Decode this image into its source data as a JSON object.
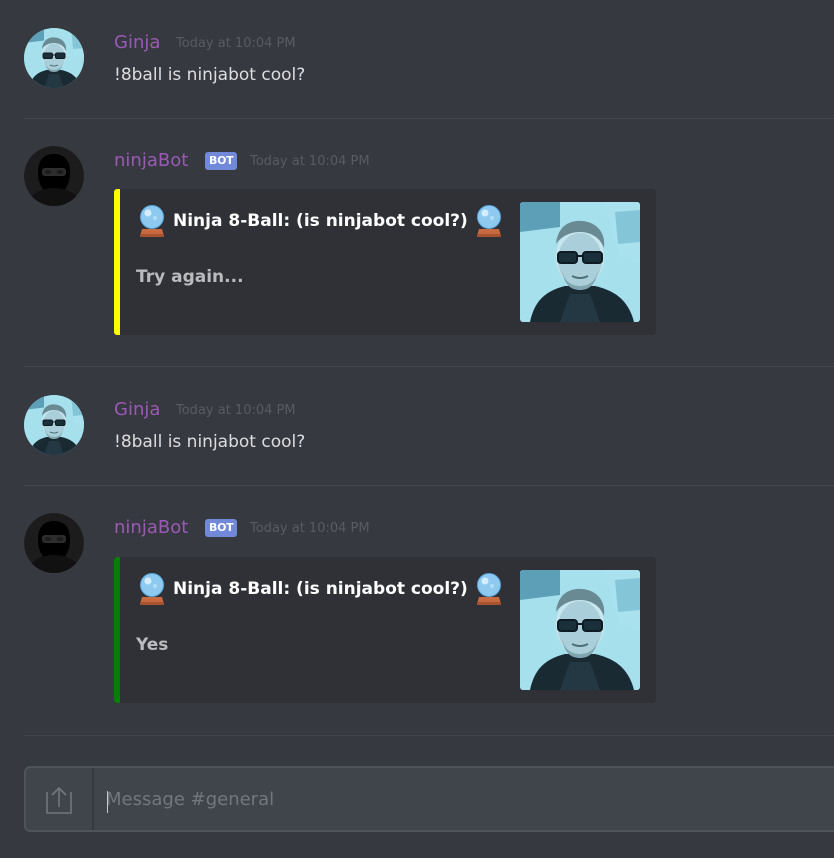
{
  "colors": {
    "background": "#36393f",
    "user_name": "#9b59b6",
    "bot_name": "#9b59b6",
    "bot_badge": "#7289da",
    "embed_bg": "#2f3136",
    "embed_bar_1": "#ffff00",
    "embed_bar_2": "#008000"
  },
  "messages": [
    {
      "author": "Ginja",
      "avatar_icon": "user-avatar-photo",
      "timestamp": "Today at 10:04 PM",
      "content": "!8ball is ninjabot cool?"
    },
    {
      "author": "ninjaBot",
      "badge": "BOT",
      "avatar_icon": "ninja-bot-avatar",
      "timestamp": "Today at 10:04 PM",
      "embed": {
        "title": "Ninja 8-Ball: (is ninjabot cool?)",
        "title_icon": "crystal-ball-icon",
        "description": "Try again...",
        "bar_color": "yellow",
        "thumbnail_icon": "user-photo-thumbnail"
      }
    },
    {
      "author": "Ginja",
      "avatar_icon": "user-avatar-photo",
      "timestamp": "Today at 10:04 PM",
      "content": "!8ball is ninjabot cool?"
    },
    {
      "author": "ninjaBot",
      "badge": "BOT",
      "avatar_icon": "ninja-bot-avatar",
      "timestamp": "Today at 10:04 PM",
      "embed": {
        "title": "Ninja 8-Ball: (is ninjabot cool?)",
        "title_icon": "crystal-ball-icon",
        "description": "Yes",
        "bar_color": "green",
        "thumbnail_icon": "user-photo-thumbnail"
      }
    }
  ],
  "composer": {
    "upload_icon": "upload-icon",
    "placeholder": "Message #general",
    "value": ""
  }
}
